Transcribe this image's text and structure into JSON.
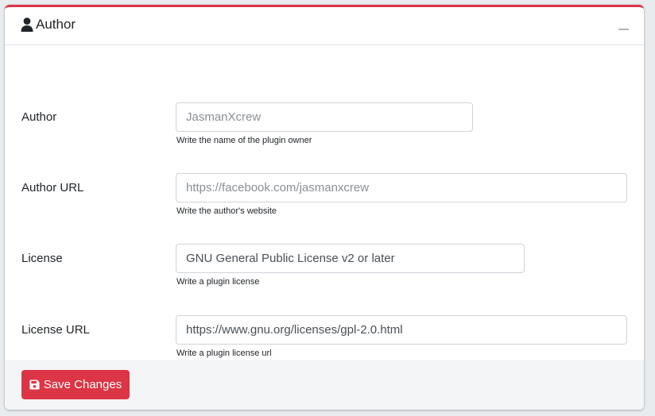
{
  "card": {
    "title": "Author",
    "accent_color": "#dc3545",
    "title_icon": "user-icon",
    "collapse_icon": "minus-icon"
  },
  "fields": [
    {
      "label": "Author",
      "value": "",
      "placeholder": "JasmanXcrew",
      "help": "Write the name of the plugin owner"
    },
    {
      "label": "Author URL",
      "value": "",
      "placeholder": "https://facebook.com/jasmanxcrew",
      "help": "Write the author's website"
    },
    {
      "label": "License",
      "value": "GNU General Public License v2 or later",
      "placeholder": "",
      "help": "Write a plugin license"
    },
    {
      "label": "License URL",
      "value": "https://www.gnu.org/licenses/gpl-2.0.html",
      "placeholder": "",
      "help": "Write a plugin license url"
    }
  ],
  "footer": {
    "save_label": "Save Changes",
    "save_icon": "floppy-disk-icon"
  }
}
